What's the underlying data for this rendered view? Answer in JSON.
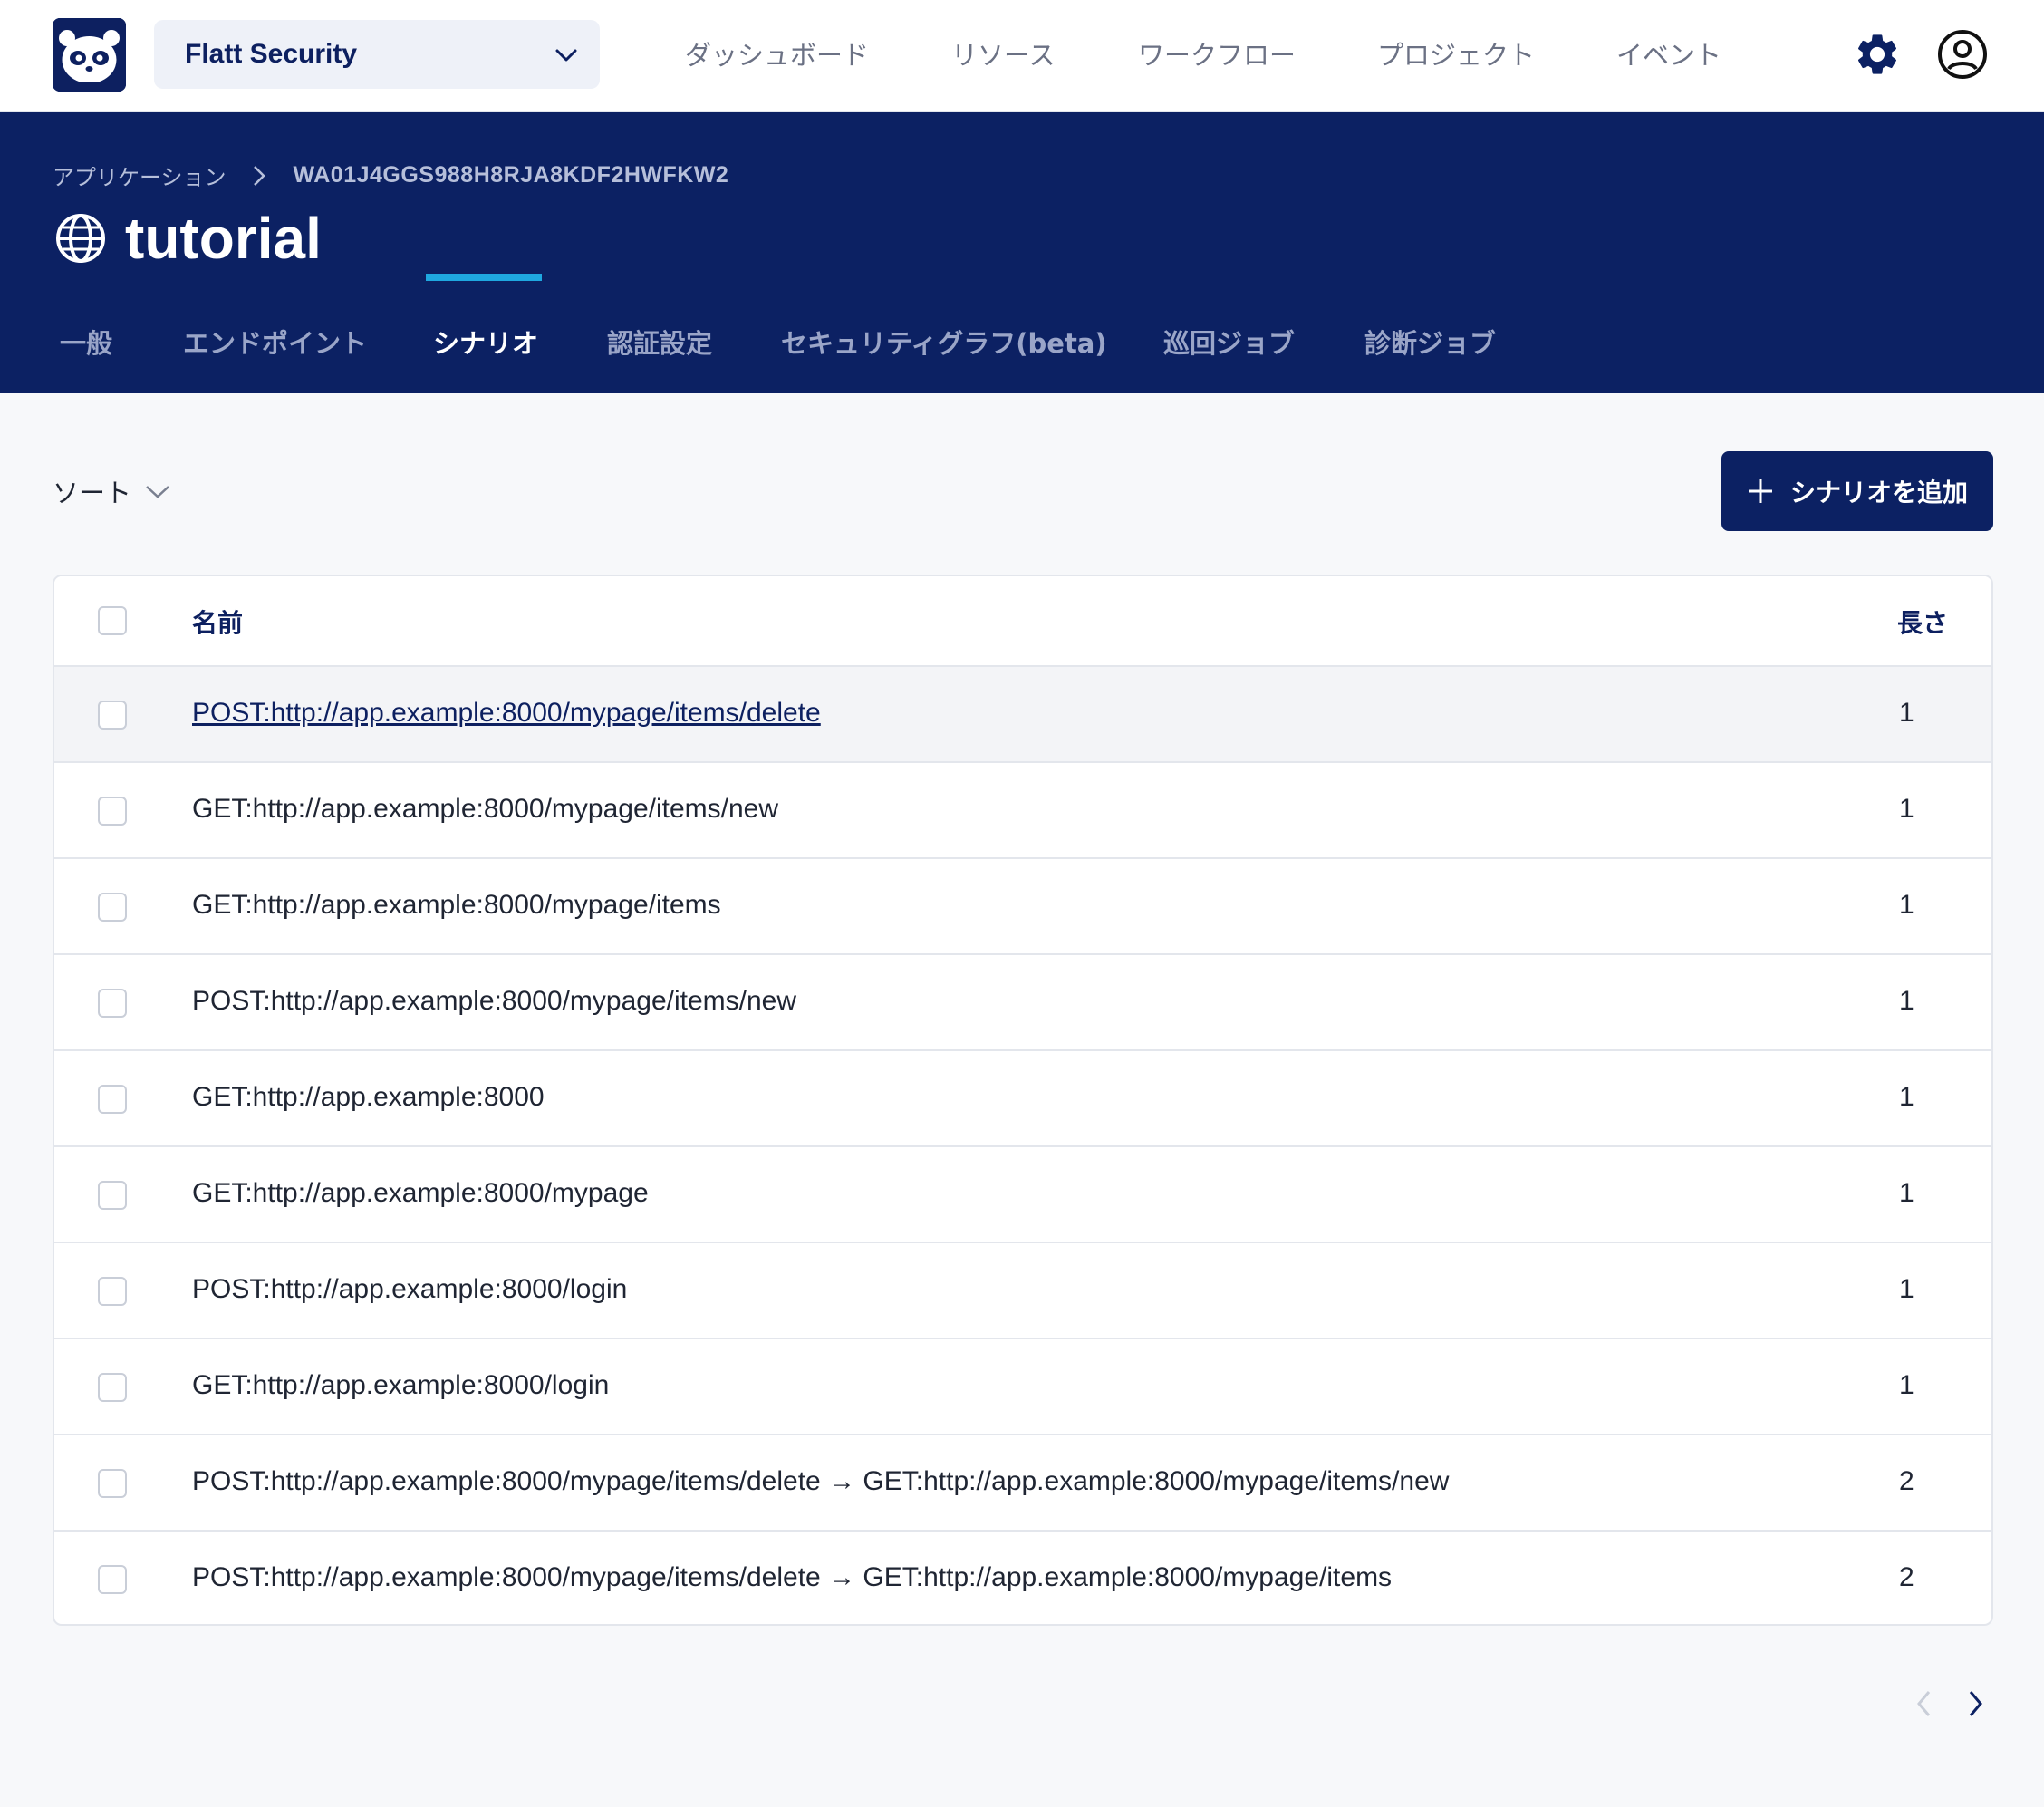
{
  "org": {
    "name": "Flatt Security"
  },
  "nav": {
    "links": [
      "ダッシュボード",
      "リソース",
      "ワークフロー",
      "プロジェクト",
      "イベント"
    ]
  },
  "breadcrumb": {
    "parent": "アプリケーション",
    "current": "WA01J4GGS988H8RJA8KDF2HWFKW2"
  },
  "app": {
    "title": "tutorial"
  },
  "tabs": [
    "一般",
    "エンドポイント",
    "シナリオ",
    "認証設定",
    "セキュリティグラフ(beta)",
    "巡回ジョブ",
    "診断ジョブ"
  ],
  "active_tab": "シナリオ",
  "toolbar": {
    "sort_label": "ソート",
    "add_label": "シナリオを追加"
  },
  "table": {
    "headers": {
      "name": "名前",
      "length": "長さ"
    },
    "rows": [
      {
        "name": "POST:http://app.example:8000/mypage/items/delete",
        "length": "1"
      },
      {
        "name": "GET:http://app.example:8000/mypage/items/new",
        "length": "1"
      },
      {
        "name": "GET:http://app.example:8000/mypage/items",
        "length": "1"
      },
      {
        "name": "POST:http://app.example:8000/mypage/items/new",
        "length": "1"
      },
      {
        "name": "GET:http://app.example:8000",
        "length": "1"
      },
      {
        "name": "GET:http://app.example:8000/mypage",
        "length": "1"
      },
      {
        "name": "POST:http://app.example:8000/login",
        "length": "1"
      },
      {
        "name": "GET:http://app.example:8000/login",
        "length": "1"
      },
      {
        "name": "POST:http://app.example:8000/mypage/items/delete → GET:http://app.example:8000/mypage/items/new",
        "length": "2"
      },
      {
        "name": "POST:http://app.example:8000/mypage/items/delete → GET:http://app.example:8000/mypage/items",
        "length": "2"
      }
    ]
  },
  "colors": {
    "brand": "#0c2163",
    "accent": "#1fa8e0"
  },
  "icons": [
    "panda-logo-icon",
    "chevron-down-icon",
    "gear-icon",
    "user-circle-icon",
    "chevron-right-icon",
    "globe-icon",
    "plus-icon",
    "chevron-left-icon"
  ]
}
